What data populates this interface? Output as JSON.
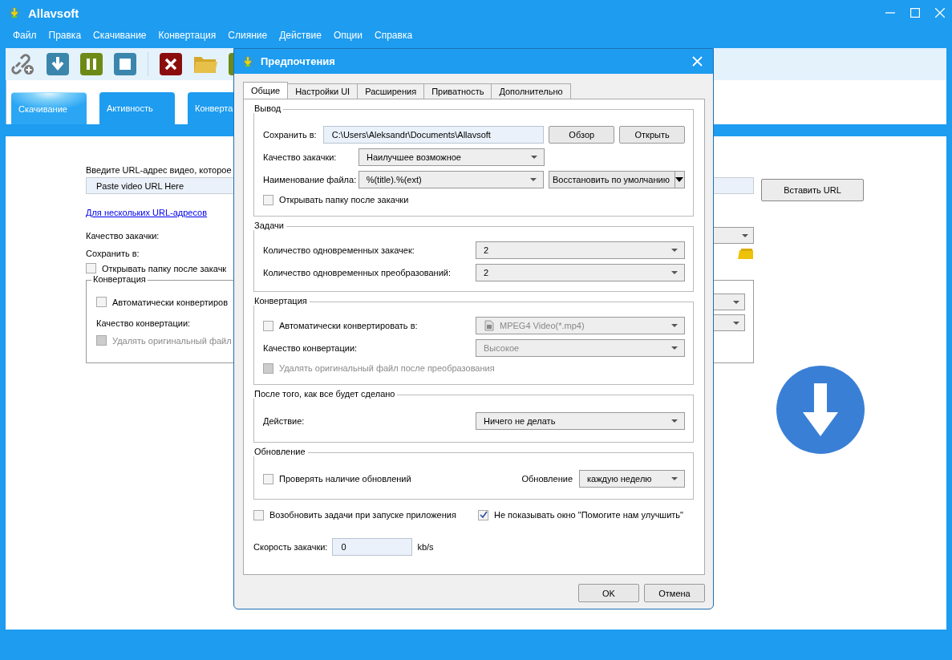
{
  "window": {
    "title": "Allavsoft"
  },
  "menu": [
    "Файл",
    "Правка",
    "Скачивание",
    "Конвертация",
    "Слияние",
    "Действие",
    "Опции",
    "Справка"
  ],
  "tabs": [
    {
      "label": "Скачивание",
      "selected": true
    },
    {
      "label": "Активность",
      "selected": false
    },
    {
      "label": "Конверта",
      "selected": false
    }
  ],
  "main": {
    "url_prompt": "Введите URL-адрес видео, которое",
    "url_placeholder": "Paste video URL Here",
    "multi_link": "Для нескольких URL-адресов",
    "quality_label": "Качество закачки:",
    "save_label": "Сохранить в:",
    "open_folder": {
      "label": "Открывать папку после закачк",
      "checked": false
    },
    "conversion": {
      "title": "Конвертация",
      "auto": {
        "label": "Автоматически конвертиров",
        "checked": false
      },
      "quality_label": "Качество конвертации:",
      "delete_original": {
        "label": "Удалять оригинальный файл",
        "checked": false,
        "disabled": true
      }
    },
    "paste_button": "Вставить URL"
  },
  "dialog": {
    "title": "Предпочтения",
    "tabs": [
      {
        "label": "Общие",
        "selected": true
      },
      {
        "label": "Настройки UI",
        "selected": false
      },
      {
        "label": "Расширения",
        "selected": false
      },
      {
        "label": "Приватность",
        "selected": false
      },
      {
        "label": "Дополнительно",
        "selected": false
      }
    ],
    "output": {
      "title": "Вывод",
      "save_label": "Сохранить в:",
      "save_path": "C:\\Users\\Aleksandr\\Documents\\Allavsoft",
      "browse_button": "Обзор",
      "open_button": "Открыть",
      "quality_label": "Качество закачки:",
      "quality_value": "Наилучшее возможное",
      "filename_label": "Наименование файла:",
      "filename_value": "%(title).%(ext)",
      "restore_button": "Восстановить по умолчанию",
      "open_folder": {
        "label": "Открывать папку после закачки",
        "checked": false
      }
    },
    "tasks": {
      "title": "Задачи",
      "rows": [
        {
          "label": "Количество одновременных закачек:",
          "value": "2"
        },
        {
          "label": "Количество одновременных преобразований:",
          "value": "2"
        }
      ]
    },
    "conversion": {
      "title": "Конвертация",
      "auto": {
        "label": "Автоматически конвертировать в:",
        "checked": false
      },
      "format_value": "MPEG4 Video(*.mp4)",
      "format_disabled": true,
      "quality_label": "Качество конвертации:",
      "quality_value": "Высокое",
      "quality_disabled": true,
      "delete_original": {
        "label": "Удалять оригинальный файл после преобразования",
        "checked": false,
        "disabled": true
      }
    },
    "after": {
      "title": "После того, как все будет сделано",
      "action_label": "Действие:",
      "action_value": "Ничего не делать"
    },
    "update": {
      "title": "Обновление",
      "check": {
        "label": "Проверять наличие обновлений",
        "checked": false
      },
      "frequency_label": "Обновление",
      "frequency_value": "каждую неделю"
    },
    "resume": {
      "label": "Возобновить задачи при запуске приложения",
      "checked": false
    },
    "no_help": {
      "label": "Не показывать окно \"Помогите нам улучшить\"",
      "checked": true
    },
    "speed_label": "Скорость закачки:",
    "speed_value": "0",
    "speed_unit": "kb/s",
    "buttons": [
      "OK",
      "Отмена"
    ]
  }
}
